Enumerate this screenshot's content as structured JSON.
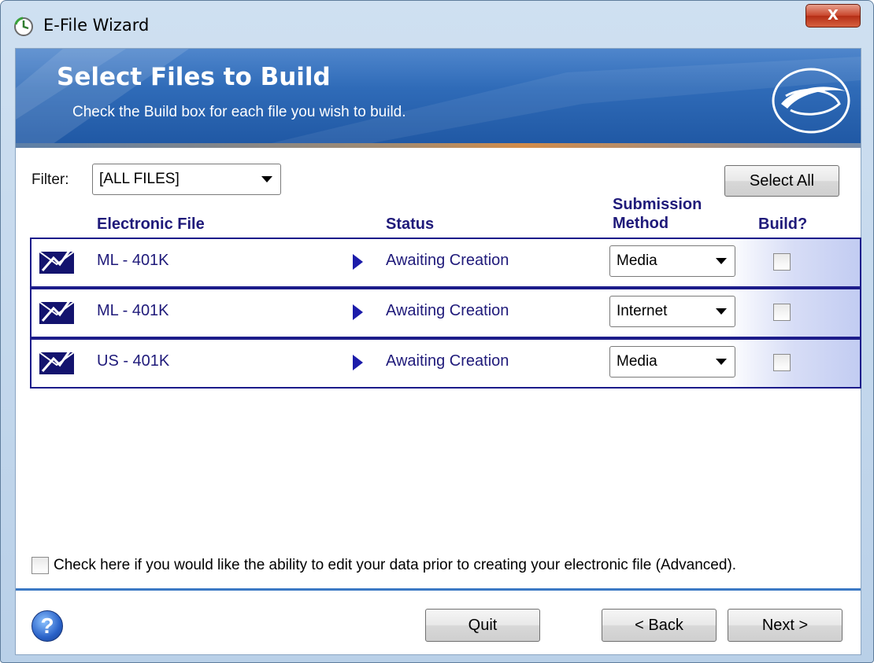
{
  "window": {
    "title": "E-File Wizard",
    "close_label": "X",
    "colors": {
      "banner": "#2f6bb8",
      "row_border": "#1c1c8a",
      "header_text": "#1f1a7a",
      "divider": "#3b79c4"
    }
  },
  "banner": {
    "title": "Select Files to Build",
    "subtitle": "Check the Build box for each file you wish to build.",
    "logo_icon": "e-logo-icon"
  },
  "filter": {
    "label": "Filter:",
    "value": "[ALL FILES]"
  },
  "select_all_label": "Select All",
  "columns": {
    "file": "Electronic File",
    "status": "Status",
    "method_line1": "Submission",
    "method_line2": "Method",
    "build": "Build?"
  },
  "files": [
    {
      "name": "ML - 401K",
      "status": "Awaiting Creation",
      "method": "Media",
      "build": false
    },
    {
      "name": "ML - 401K",
      "status": "Awaiting Creation",
      "method": "Internet",
      "build": false
    },
    {
      "name": "US - 401K",
      "status": "Awaiting Creation",
      "method": "Media",
      "build": false
    }
  ],
  "advanced": {
    "checked": false,
    "label": "Check here if you would like the ability to edit your data prior to creating your electronic file (Advanced)."
  },
  "footer": {
    "help_label": "?",
    "quit_label": "Quit",
    "back_label": "< Back",
    "next_label": "Next >"
  }
}
